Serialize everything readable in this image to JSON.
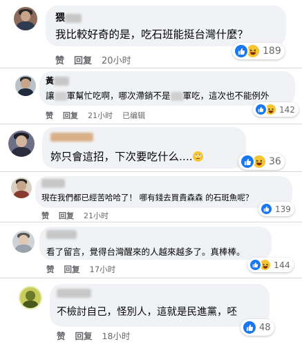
{
  "comments": [
    {
      "commenter_visible": "猥",
      "text": "我比較好奇的是，吃石班能挺台灣什麼？",
      "like_label": "赞",
      "reply_label": "回复",
      "time": "20小时",
      "edited": "",
      "reaction_count": "189",
      "reactions": [
        "like-icon",
        "haha-icon"
      ]
    },
    {
      "commenter_visible": "黃",
      "text_parts": [
        "讓",
        "軍幫忙吃啊，哪次滯銷不是",
        "軍吃，這次也不能例外"
      ],
      "like_label": "赞",
      "reply_label": "回复",
      "time": "21小时",
      "edited": "已编辑",
      "reaction_count": "142",
      "reactions": [
        "like-icon",
        "haha-icon"
      ]
    },
    {
      "commenter_visible": "",
      "text": "妳只會這招，下次要吃什么....",
      "like_label": "赞",
      "reply_label": "回复",
      "time": "21小时",
      "edited": "",
      "reaction_count": "36",
      "reactions": [
        "like-icon",
        "haha-icon"
      ]
    },
    {
      "commenter_visible": "",
      "text": "現在我們都已經苦哈哈了！ 哪有錢去買貴森森 的石斑魚呢？",
      "like_label": "赞",
      "reply_label": "回复",
      "time": "21小时",
      "edited": "",
      "reaction_count": "139",
      "reactions": [
        "like-icon"
      ]
    },
    {
      "commenter_visible": "",
      "text": "看了留言，覺得台灣醒來的人越來越多了。真棒棒。",
      "like_label": "赞",
      "reply_label": "回复",
      "time": "17小时",
      "edited": "",
      "reaction_count": "144",
      "reactions": [
        "like-icon",
        "haha-icon"
      ]
    },
    {
      "commenter_visible": "",
      "text": "不檢討自己，怪別人，這就是民進黨，呸",
      "like_label": "赞",
      "reply_label": "回复",
      "time": "18小时",
      "edited": "",
      "reaction_count": "48",
      "reactions": [
        "like-icon"
      ]
    }
  ],
  "colors": {
    "bubble": "#f0f2f5",
    "meta": "#65676b",
    "like": "#1877f2",
    "haha": "#f7c531"
  }
}
